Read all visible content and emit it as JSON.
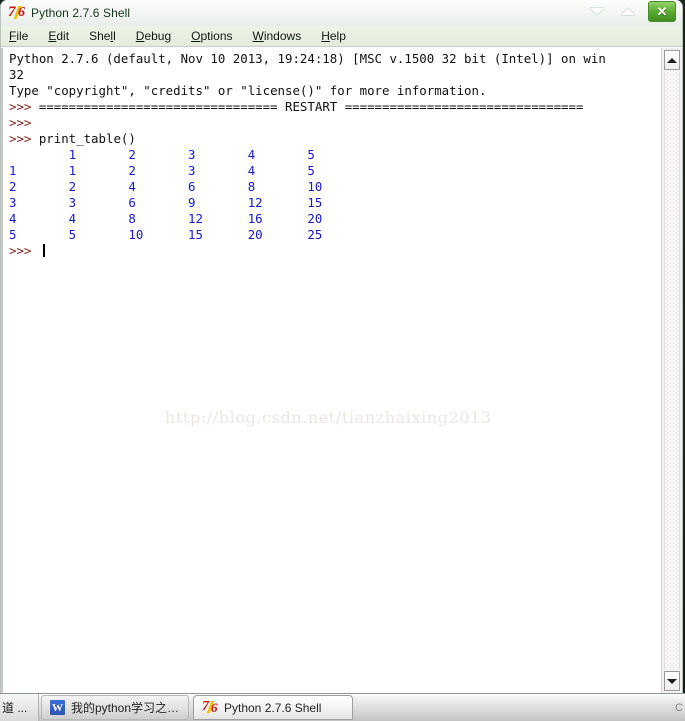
{
  "window": {
    "title": "Python 2.7.6 Shell",
    "icon": "python-idle-icon",
    "controls": {
      "minimize": "▼",
      "maximize": "▲",
      "close": "✕"
    }
  },
  "menubar": {
    "items": [
      {
        "label": "File",
        "pre": "",
        "key": "F",
        "post": "ile"
      },
      {
        "label": "Edit",
        "pre": "",
        "key": "E",
        "post": "dit"
      },
      {
        "label": "Shell",
        "pre": "She",
        "key": "l",
        "post": "l"
      },
      {
        "label": "Debug",
        "pre": "",
        "key": "D",
        "post": "ebug"
      },
      {
        "label": "Options",
        "pre": "",
        "key": "O",
        "post": "ptions"
      },
      {
        "label": "Windows",
        "pre": "",
        "key": "W",
        "post": "indows"
      },
      {
        "label": "Help",
        "pre": "",
        "key": "H",
        "post": "elp"
      }
    ]
  },
  "console": {
    "banner_line_1": "Python 2.7.6 (default, Nov 10 2013, 19:24:18) [MSC v.1500 32 bit (Intel)] on win",
    "banner_line_2": "32",
    "banner_line_3": "Type \"copyright\", \"credits\" or \"license()\" for more information.",
    "prompt": ">>> ",
    "restart_separator": "================================ RESTART ================================",
    "command": "print_table()",
    "table": {
      "header_row": [
        "",
        "1",
        "2",
        "3",
        "4",
        "5"
      ],
      "rows": [
        [
          "1",
          "1",
          "2",
          "3",
          "4",
          "5"
        ],
        [
          "2",
          "2",
          "4",
          "6",
          "8",
          "10"
        ],
        [
          "3",
          "3",
          "6",
          "9",
          "12",
          "15"
        ],
        [
          "4",
          "4",
          "8",
          "12",
          "16",
          "20"
        ],
        [
          "5",
          "5",
          "10",
          "15",
          "20",
          "25"
        ]
      ]
    },
    "colors": {
      "prompt": "#7d2020",
      "output": "#1717cf",
      "stdout_text": "#111111"
    }
  },
  "watermark": {
    "text": "http://blog.csdn.net/tianzhaixing2013"
  },
  "scrollbar": {
    "up_arrow": "up-arrow",
    "down_arrow": "down-arrow"
  },
  "taskbar": {
    "clipped_item": "道 ...",
    "items": [
      {
        "label": "我的python学习之旅...",
        "icon": "word-icon",
        "active": false
      },
      {
        "label": "Python 2.7.6 Shell",
        "icon": "python-idle-icon",
        "active": true
      }
    ],
    "tray": "C"
  }
}
